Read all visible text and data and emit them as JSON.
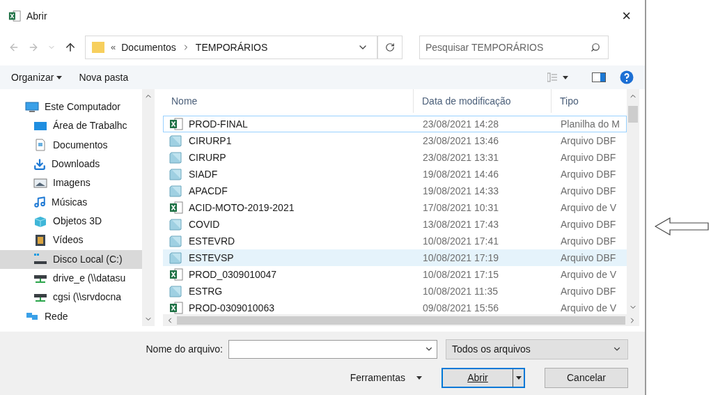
{
  "window": {
    "title": "Abrir",
    "close": "×"
  },
  "address": {
    "prefix": "«",
    "path": [
      "Documentos",
      "TEMPORÁRIOS"
    ],
    "search_placeholder": "Pesquisar TEMPORÁRIOS"
  },
  "toolbar": {
    "organize": "Organizar",
    "new_folder": "Nova pasta"
  },
  "sidebar": {
    "items": [
      {
        "kind": "computer",
        "label": "Este Computador",
        "selected": false
      },
      {
        "kind": "desktop",
        "label": "Área de Trabalhc",
        "selected": false
      },
      {
        "kind": "documents",
        "label": "Documentos",
        "selected": false
      },
      {
        "kind": "downloads",
        "label": "Downloads",
        "selected": false
      },
      {
        "kind": "pictures",
        "label": "Imagens",
        "selected": false
      },
      {
        "kind": "music",
        "label": "Músicas",
        "selected": false
      },
      {
        "kind": "objects",
        "label": "Objetos 3D",
        "selected": false
      },
      {
        "kind": "videos",
        "label": "Vídeos",
        "selected": false
      },
      {
        "kind": "disk",
        "label": "Disco Local (C:)",
        "selected": true
      },
      {
        "kind": "netdrive",
        "label": "drive_e (\\\\datasu",
        "selected": false
      },
      {
        "kind": "netdrive",
        "label": "cgsi (\\\\srvdocna",
        "selected": false
      },
      {
        "kind": "network",
        "label": "Rede",
        "selected": false
      }
    ]
  },
  "table": {
    "columns": [
      "Nome",
      "Data de modificação",
      "Tipo"
    ],
    "rows": [
      {
        "kind": "excel",
        "name": "PROD-FINAL",
        "date": "23/08/2021 14:28",
        "type": "Planilha do M",
        "selected": false,
        "focused": true
      },
      {
        "kind": "dbf",
        "name": "CIRURP1",
        "date": "23/08/2021 13:46",
        "type": "Arquivo DBF",
        "selected": false,
        "focused": false
      },
      {
        "kind": "dbf",
        "name": "CIRURP",
        "date": "23/08/2021 13:31",
        "type": "Arquivo DBF",
        "selected": false,
        "focused": false
      },
      {
        "kind": "dbf",
        "name": "SIADF",
        "date": "19/08/2021 14:46",
        "type": "Arquivo DBF",
        "selected": false,
        "focused": false
      },
      {
        "kind": "dbf",
        "name": "APACDF",
        "date": "19/08/2021 14:33",
        "type": "Arquivo DBF",
        "selected": false,
        "focused": false
      },
      {
        "kind": "excel",
        "name": "ACID-MOTO-2019-2021",
        "date": "17/08/2021 10:31",
        "type": "Arquivo de V",
        "selected": false,
        "focused": false
      },
      {
        "kind": "dbf",
        "name": "COVID",
        "date": "13/08/2021 17:43",
        "type": "Arquivo DBF",
        "selected": false,
        "focused": false
      },
      {
        "kind": "dbf",
        "name": "ESTEVRD",
        "date": "10/08/2021 17:41",
        "type": "Arquivo DBF",
        "selected": false,
        "focused": false
      },
      {
        "kind": "dbf",
        "name": "ESTEVSP",
        "date": "10/08/2021 17:19",
        "type": "Arquivo DBF",
        "selected": true,
        "focused": false
      },
      {
        "kind": "excel",
        "name": "PROD_0309010047",
        "date": "10/08/2021 17:15",
        "type": "Arquivo de V",
        "selected": false,
        "focused": false
      },
      {
        "kind": "dbf",
        "name": "ESTRG",
        "date": "10/08/2021 11:35",
        "type": "Arquivo DBF",
        "selected": false,
        "focused": false
      },
      {
        "kind": "excel",
        "name": "PROD-0309010063",
        "date": "09/08/2021 15:56",
        "type": "Arquivo de V",
        "selected": false,
        "focused": false
      }
    ]
  },
  "footer": {
    "filename_label": "Nome do arquivo:",
    "filter": "Todos os arquivos",
    "tools": "Ferramentas",
    "open": "Abrir",
    "cancel": "Cancelar"
  }
}
